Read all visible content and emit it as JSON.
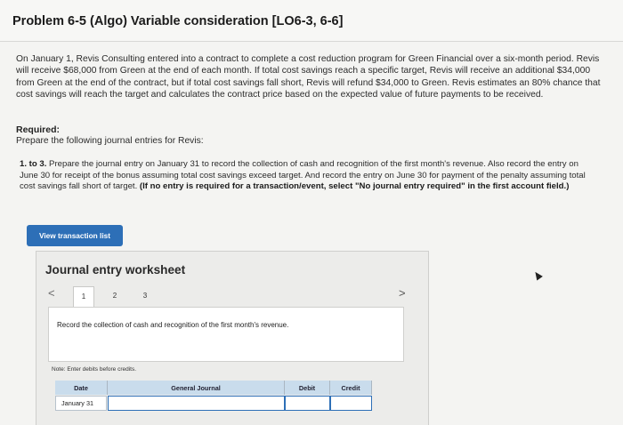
{
  "problem": {
    "title": "Problem 6-5 (Algo) Variable consideration [LO6-3, 6-6]",
    "intro": "On January 1, Revis Consulting entered into a contract to complete a cost reduction program for Green Financial over a six-month period. Revis will receive $68,000 from Green at the end of each month. If total cost savings reach a specific target, Revis will receive an additional $34,000 from Green at the end of the contract, but if total cost savings fall short, Revis will refund $34,000 to Green. Revis estimates an 80% chance that cost savings will reach the target and calculates the contract price based on the expected value of future payments to be received.",
    "required_heading": "Required:",
    "required_text": "Prepare the following journal entries for Revis:",
    "instructions_prefix": "1. to 3.",
    "instructions_body": " Prepare the journal entry on January 31 to record the collection of cash and recognition of the first month's revenue. Also record the entry on June 30 for receipt of the bonus assuming total cost savings exceed target. And record the entry on June 30 for payment of the penalty assuming total cost savings fall short of target. ",
    "instructions_bold": "(If no entry is required for a transaction/event, select \"No journal entry required\" in the first account field.)"
  },
  "view_button": "View transaction list",
  "worksheet": {
    "title": "Journal entry worksheet",
    "prev": "<",
    "next": ">",
    "tabs": [
      "1",
      "2",
      "3"
    ],
    "active_tab": "1",
    "record_text": "Record the collection of cash and recognition of the first month's revenue.",
    "note": "Note: Enter debits before credits.",
    "table": {
      "headers": [
        "Date",
        "General Journal",
        "Debit",
        "Credit"
      ],
      "rows": [
        {
          "date": "January 31",
          "account": "",
          "debit": "",
          "credit": ""
        }
      ]
    }
  },
  "colors": {
    "button_bg": "#2d6fb7",
    "header_bg": "#c9dcec"
  }
}
